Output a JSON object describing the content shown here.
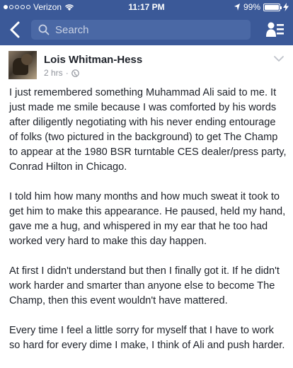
{
  "status_bar": {
    "carrier": "Verizon",
    "time": "11:17 PM",
    "battery_percent": "99%",
    "battery_level": 0.99
  },
  "nav": {
    "search_placeholder": "Search"
  },
  "post": {
    "author": "Lois Whitman-Hess",
    "time": "2 hrs",
    "separator": "·",
    "paragraphs": [
      "I just remembered something Muhammad Ali said to me. It just made me smile because I was comforted by his words after diligently negotiating with his never ending entourage of folks (two pictured in the background) to get The Champ to appear at the 1980 BSR turntable CES dealer/press party, Conrad Hilton in Chicago.",
      "I told him how many months and how much sweat it took to get him to make this appearance.  He paused, held my hand, gave me a hug, and whispered in my ear that he too had worked very hard to make this day happen.",
      "At first I didn't understand but then I finally got it. If he didn't work harder and smarter than anyone else to become The Champ, then this event wouldn't have mattered.",
      "Every time I feel a little sorry for myself that I have to work so hard for every dime I make, I think of Ali and push harder."
    ]
  }
}
